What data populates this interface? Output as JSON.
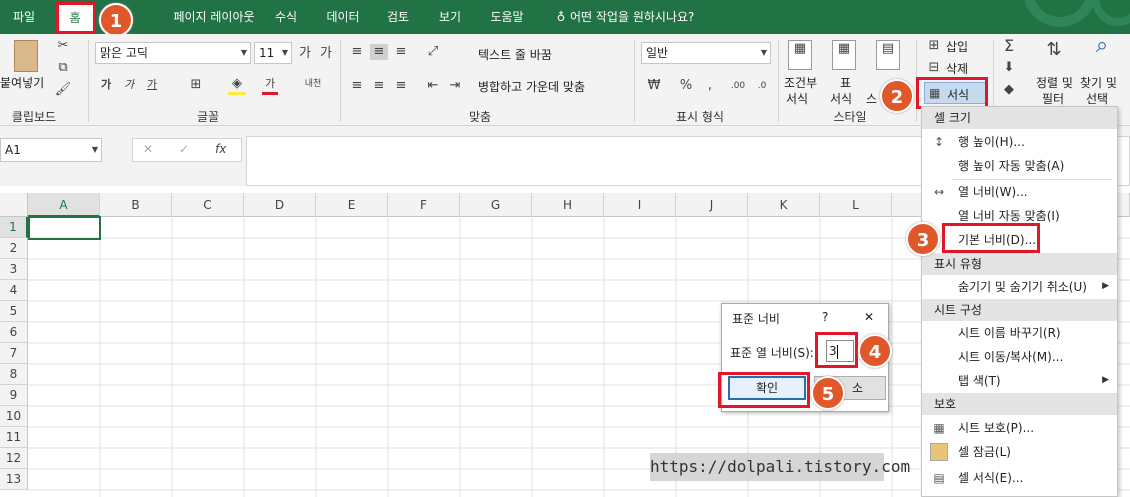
{
  "tabs": [
    "파일",
    "홈",
    "페이지 레이아웃",
    "수식",
    "데이터",
    "검토",
    "보기",
    "도움말"
  ],
  "tell_me": "어떤 작업을 원하시나요?",
  "clipboard": {
    "paste": "붙여넣기",
    "label": "클립보드"
  },
  "font": {
    "name": "맑은 고딕",
    "size": "11",
    "label": "글꼴",
    "bold": "가",
    "italic": "가",
    "underline": "가",
    "font_color": "가",
    "phonetic": "내천"
  },
  "align": {
    "wrap": "텍스트 줄 바꿈",
    "merge": "병합하고 가운데 맞춤",
    "label": "맞춤"
  },
  "number": {
    "format": "일반",
    "label": "표시 형식",
    "percent": "%"
  },
  "styles": {
    "cond": "조건부",
    "cond2": "서식",
    "table": "표",
    "table2": "서식",
    "cell": "스",
    "label": "스타일"
  },
  "cells": {
    "insert": "삽입",
    "delete": "삭제",
    "format": "서식"
  },
  "editing": {
    "sort": "정렬 및",
    "sort2": "필터",
    "find": "찾기 및",
    "find2": "선택"
  },
  "namebox": "A1",
  "fx": "fx",
  "columns": [
    "A",
    "B",
    "C",
    "D",
    "E",
    "F",
    "G",
    "H",
    "I",
    "J",
    "K",
    "L"
  ],
  "rows": [
    "1",
    "2",
    "3",
    "4",
    "5",
    "6",
    "7",
    "8",
    "9",
    "10",
    "11",
    "12",
    "13"
  ],
  "menu": {
    "h_size": "셀 크기",
    "row_height": "행 높이(H)...",
    "autofit_row": "행 높이 자동 맞춤(A)",
    "col_width": "열 너비(W)...",
    "autofit_col": "열 너비 자동 맞춤(I)",
    "default_width": "기본 너비(D)...",
    "h_visibility": "표시 유형",
    "hide_unhide": "숨기기 및 숨기기 취소(U)",
    "h_organize": "시트 구성",
    "rename": "시트 이름 바꾸기(R)",
    "move_copy": "시트 이동/복사(M)...",
    "tab_color": "탭 색(T)",
    "h_protect": "보호",
    "protect_sheet": "시트 보호(P)...",
    "lock_cell": "셀 잠금(L)",
    "format_cells": "셀 서식(E)..."
  },
  "dialog": {
    "title": "표준 너비",
    "help": "?",
    "close": "✕",
    "label": "표준 열 너비(S):",
    "value": "3",
    "ok": "확인",
    "cancel": "소"
  },
  "badges": [
    "1",
    "2",
    "3",
    "4",
    "5"
  ],
  "watermark": "https://dolpali.tistory.com",
  "colors": {
    "green": "#217346",
    "badge": "#e0572a",
    "red": "#e0162b"
  }
}
